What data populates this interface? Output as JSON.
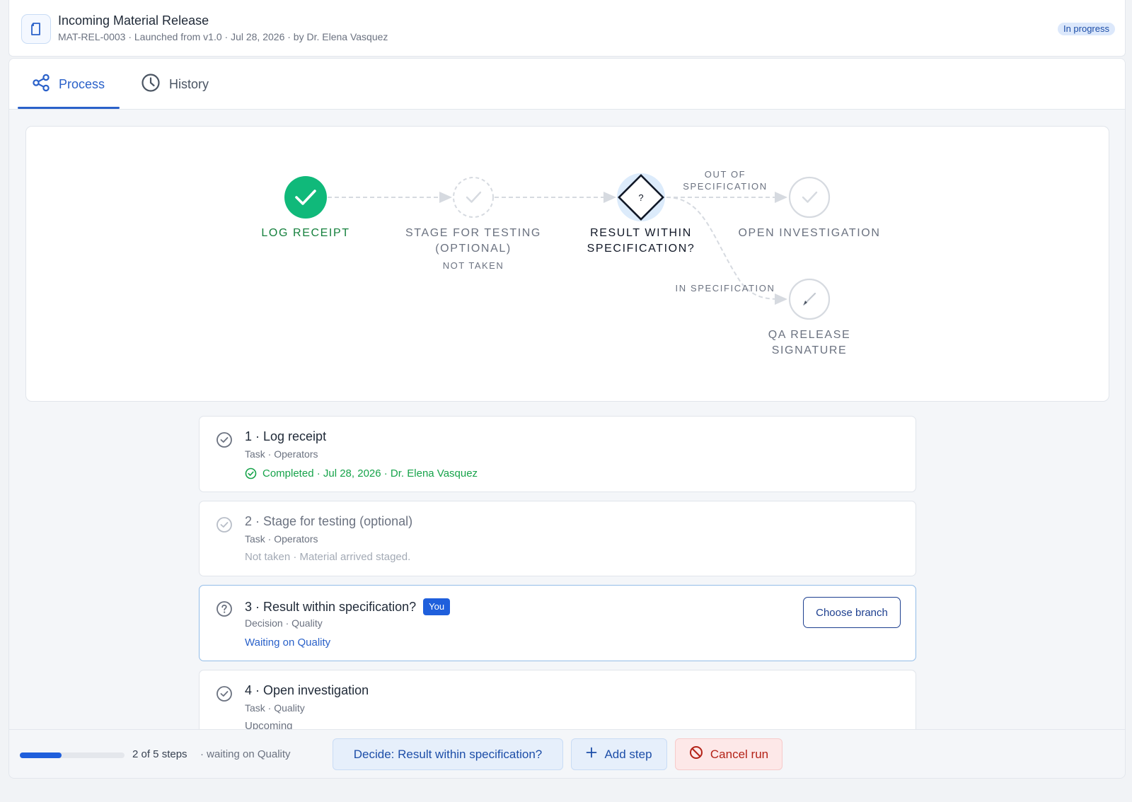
{
  "header": {
    "title": "Incoming Material Release",
    "subtitle": "MAT-REL-0003 · Launched from v1.0 · Jul 28, 2026 · by Dr. Elena Vasquez",
    "status": "In progress"
  },
  "tabs": [
    {
      "label": "Process",
      "icon": "share-nodes-icon",
      "active": true
    },
    {
      "label": "History",
      "icon": "clock-icon",
      "active": false
    }
  ],
  "flow": {
    "nodes": [
      {
        "label": "LOG RECEIPT",
        "state": "done"
      },
      {
        "label": "STAGE FOR TESTING (OPTIONAL)",
        "sub": "NOT TAKEN",
        "state": "skipped"
      },
      {
        "label": "RESULT WITHIN SPECIFICATION?",
        "state": "current",
        "glyph": "?"
      },
      {
        "label": "OPEN INVESTIGATION",
        "state": "upcoming"
      },
      {
        "label": "QA RELEASE SIGNATURE",
        "state": "upcoming"
      }
    ],
    "edges": [
      {
        "label": "OUT OF SPECIFICATION"
      },
      {
        "label": "IN SPECIFICATION"
      }
    ],
    "colors": {
      "done": "#10b97a",
      "current_halo": "#dcebfb",
      "pending": "#d6dae0"
    }
  },
  "steps": [
    {
      "title": "1 · Log receipt",
      "meta": "Task · Operators",
      "status": "Completed · Jul 28, 2026 · Dr. Elena Vasquez",
      "state": "done"
    },
    {
      "title": "2 · Stage for testing (optional)",
      "meta": "Task · Operators",
      "status": "Not taken · Material arrived staged.",
      "state": "skipped"
    },
    {
      "title": "3 · Result within specification?",
      "badge": "You",
      "meta": "Decision · Quality",
      "status": "Waiting on Quality",
      "state": "current",
      "action": "Choose branch"
    },
    {
      "title": "4 · Open investigation",
      "meta": "Task · Quality",
      "status": "Upcoming",
      "state": "upcoming"
    }
  ],
  "footer": {
    "progress_fraction": 0.4,
    "progress_text": "2 of 5 steps",
    "progress_sub": "· waiting on Quality",
    "decide_label": "Decide: Result within specification?",
    "add_label": "Add step",
    "cancel_label": "Cancel run"
  }
}
